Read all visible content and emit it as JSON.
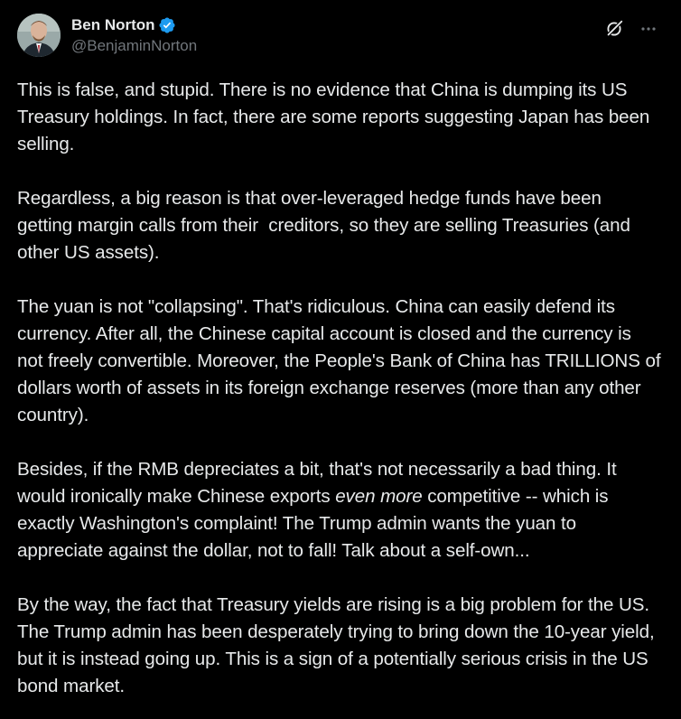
{
  "author": {
    "display_name": "Ben Norton",
    "handle": "@BenjaminNorton",
    "verified": true,
    "verified_color": "#1d9bf0"
  },
  "actions": {
    "grok_icon": "grok-icon",
    "more_icon": "more-icon",
    "more_label": "···"
  },
  "post": {
    "paragraphs": [
      "This is false, and stupid. There is no evidence that China is dumping its US Treasury holdings. In fact, there are some reports suggesting Japan has been selling.",
      "Regardless, a big reason is that over-leveraged hedge funds have been getting margin calls from their  creditors, so they are selling Treasuries (and other US assets).",
      "The yuan is not \"collapsing\". That's ridiculous. China can easily defend its currency. After all, the Chinese capital account is closed and the currency is not freely convertible. Moreover, the People's Bank of China has TRILLIONS of dollars worth of assets in its foreign exchange reserves (more than any other country).",
      "By the way, the fact that Treasury yields are rising is a big problem for the US. The Trump admin has been desperately trying to bring down the 10-year yield, but it is instead going up. This is a sign of a potentially serious crisis in the US bond market."
    ],
    "para4": {
      "before": "Besides, if the RMB depreciates a bit, that's not necessarily a bad thing. It would ironically make Chinese exports ",
      "emphasis": "even more",
      "after": " competitive -- which is exactly Washington's complaint! The Trump admin wants the yuan to appreciate against the dollar, not to fall! Talk about a self-own..."
    }
  },
  "colors": {
    "background": "#000000",
    "text": "#e7e9ea",
    "secondary": "#71767b"
  }
}
